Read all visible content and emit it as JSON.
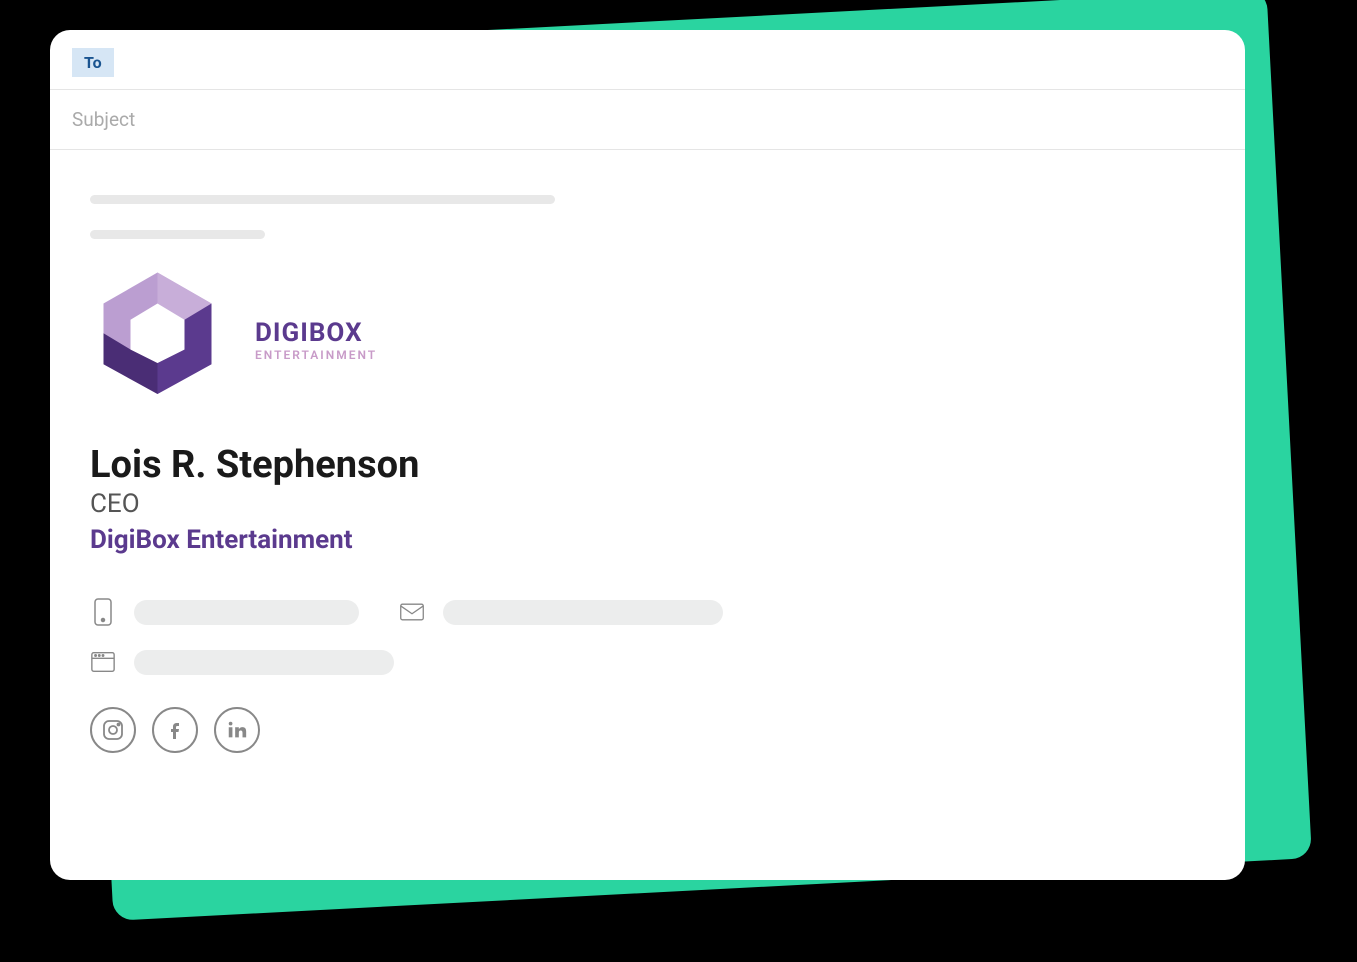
{
  "compose": {
    "to_label": "To",
    "subject_placeholder": "Subject"
  },
  "signature": {
    "logo": {
      "main": "DIGIBOX",
      "sub": "ENTERTAINMENT"
    },
    "person_name": "Lois R. Stephenson",
    "person_title": "CEO",
    "company": "DigiBox Entertainment"
  }
}
